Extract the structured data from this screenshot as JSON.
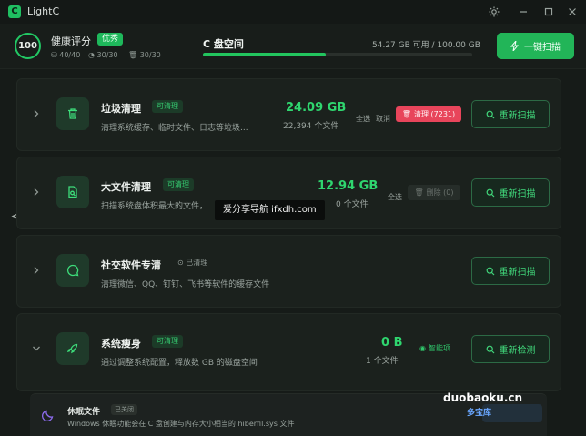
{
  "app": {
    "title": "LightC",
    "logo_letter": "C"
  },
  "header": {
    "score": "100",
    "health_label": "健康评分",
    "health_badge": "优秀",
    "stats": [
      "40/40",
      "30/30",
      "30/30"
    ],
    "disk_title": "C 盘空间",
    "disk_usage": "54.27 GB 可用 / 100.00 GB",
    "disk_used_fraction": 0.457,
    "oneclick_label": "一键扫描"
  },
  "cards": [
    {
      "title": "垃圾清理",
      "tag": "可清理",
      "desc": "清理系统缓存、临时文件、日志等垃圾...",
      "size": "24.09 GB",
      "count": "22,394 个文件",
      "select_all": "全选",
      "cancel": "取消",
      "clean_label": "清理 (7231)",
      "rescan_label": "重新扫描"
    },
    {
      "title": "大文件清理",
      "tag": "可清理",
      "desc": "扫描系统盘体积最大的文件，",
      "size": "12.94 GB",
      "count": "0 个文件",
      "select_all": "全选",
      "delete_label": "删除 (0)",
      "rescan_label": "重新扫描"
    },
    {
      "title": "社交软件专清",
      "tag": "已清理",
      "desc": "清理微信、QQ、钉钉、飞书等软件的缓存文件",
      "rescan_label": "重新扫描"
    },
    {
      "title": "系统瘦身",
      "tag": "可清理",
      "desc": "通过调整系统配置，释放数 GB 的磁盘空间",
      "size": "0 B",
      "count": "1 个文件",
      "optimized": "智能项",
      "rescan_label": "重新检测"
    }
  ],
  "subitem": {
    "title": "休眠文件",
    "tag": "已关闭",
    "desc": "Windows 休眠功能会在 C 盘创建与内存大小相当的 hiberfil.sys 文件"
  },
  "watermarks": {
    "center": "爱分享导航 ifxdh.com",
    "corner_domain": "duobaoku.cn",
    "corner_name": "多宝库"
  },
  "colors": {
    "accent": "#22c55e",
    "danger": "#e8455b",
    "background": "#161b18"
  }
}
